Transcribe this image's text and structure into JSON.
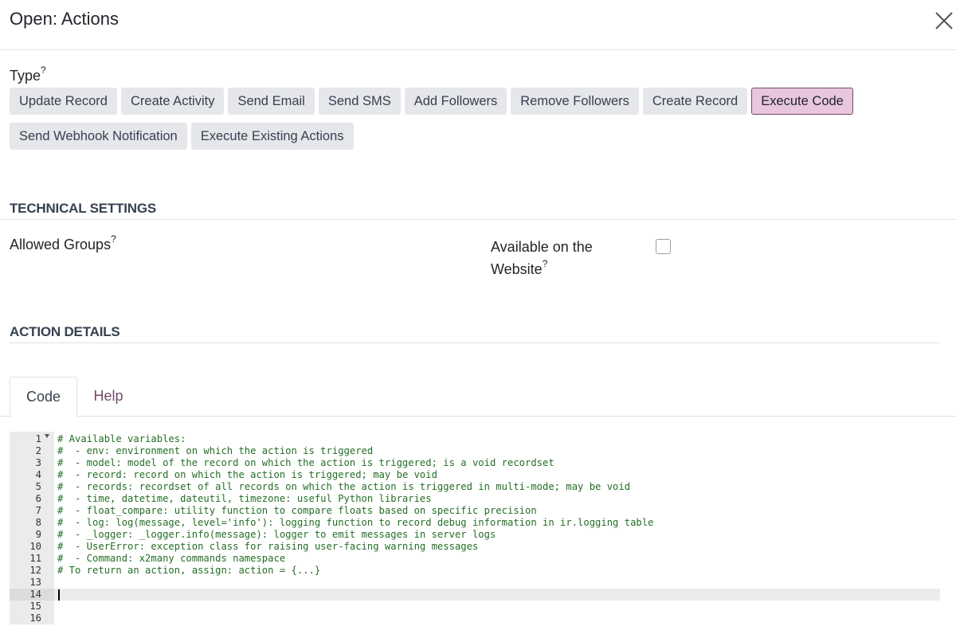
{
  "dialog": {
    "title": "Open: Actions",
    "close_icon": "close-icon"
  },
  "type_field": {
    "label": "Type",
    "help_mark": "?",
    "options": [
      "Update Record",
      "Create Activity",
      "Send Email",
      "Send SMS",
      "Add Followers",
      "Remove Followers",
      "Create Record",
      "Execute Code",
      "Send Webhook Notification",
      "Execute Existing Actions"
    ],
    "selected": "Execute Code"
  },
  "technical_settings": {
    "title": "TECHNICAL SETTINGS",
    "allowed_groups_label": "Allowed Groups",
    "allowed_groups_help": "?",
    "website_label_line1": "Available on the",
    "website_label_line2": "Website",
    "website_help": "?",
    "website_checked": false
  },
  "action_details": {
    "title": "ACTION DETAILS"
  },
  "tabs": {
    "code": "Code",
    "help": "Help",
    "active": "Code"
  },
  "editor": {
    "active_line": 14,
    "line_numbers": [
      "1",
      "2",
      "3",
      "4",
      "5",
      "6",
      "7",
      "8",
      "9",
      "10",
      "11",
      "12",
      "13",
      "14",
      "15",
      "16"
    ],
    "lines": [
      "# Available variables:",
      "#  - env: environment on which the action is triggered",
      "#  - model: model of the record on which the action is triggered; is a void recordset",
      "#  - record: record on which the action is triggered; may be void",
      "#  - records: recordset of all records on which the action is triggered in multi-mode; may be void",
      "#  - time, datetime, dateutil, timezone: useful Python libraries",
      "#  - float_compare: utility function to compare floats based on specific precision",
      "#  - log: log(message, level='info'): logging function to record debug information in ir.logging table",
      "#  - _logger: _logger.info(message): logger to emit messages in server logs",
      "#  - UserError: exception class for raising user-facing warning messages",
      "#  - Command: x2many commands namespace",
      "# To return an action, assign: action = {...}",
      "",
      "",
      "",
      ""
    ]
  },
  "colors": {
    "accent": "#714b67",
    "selected_bg": "#e8c6df",
    "comment": "#236e24"
  }
}
